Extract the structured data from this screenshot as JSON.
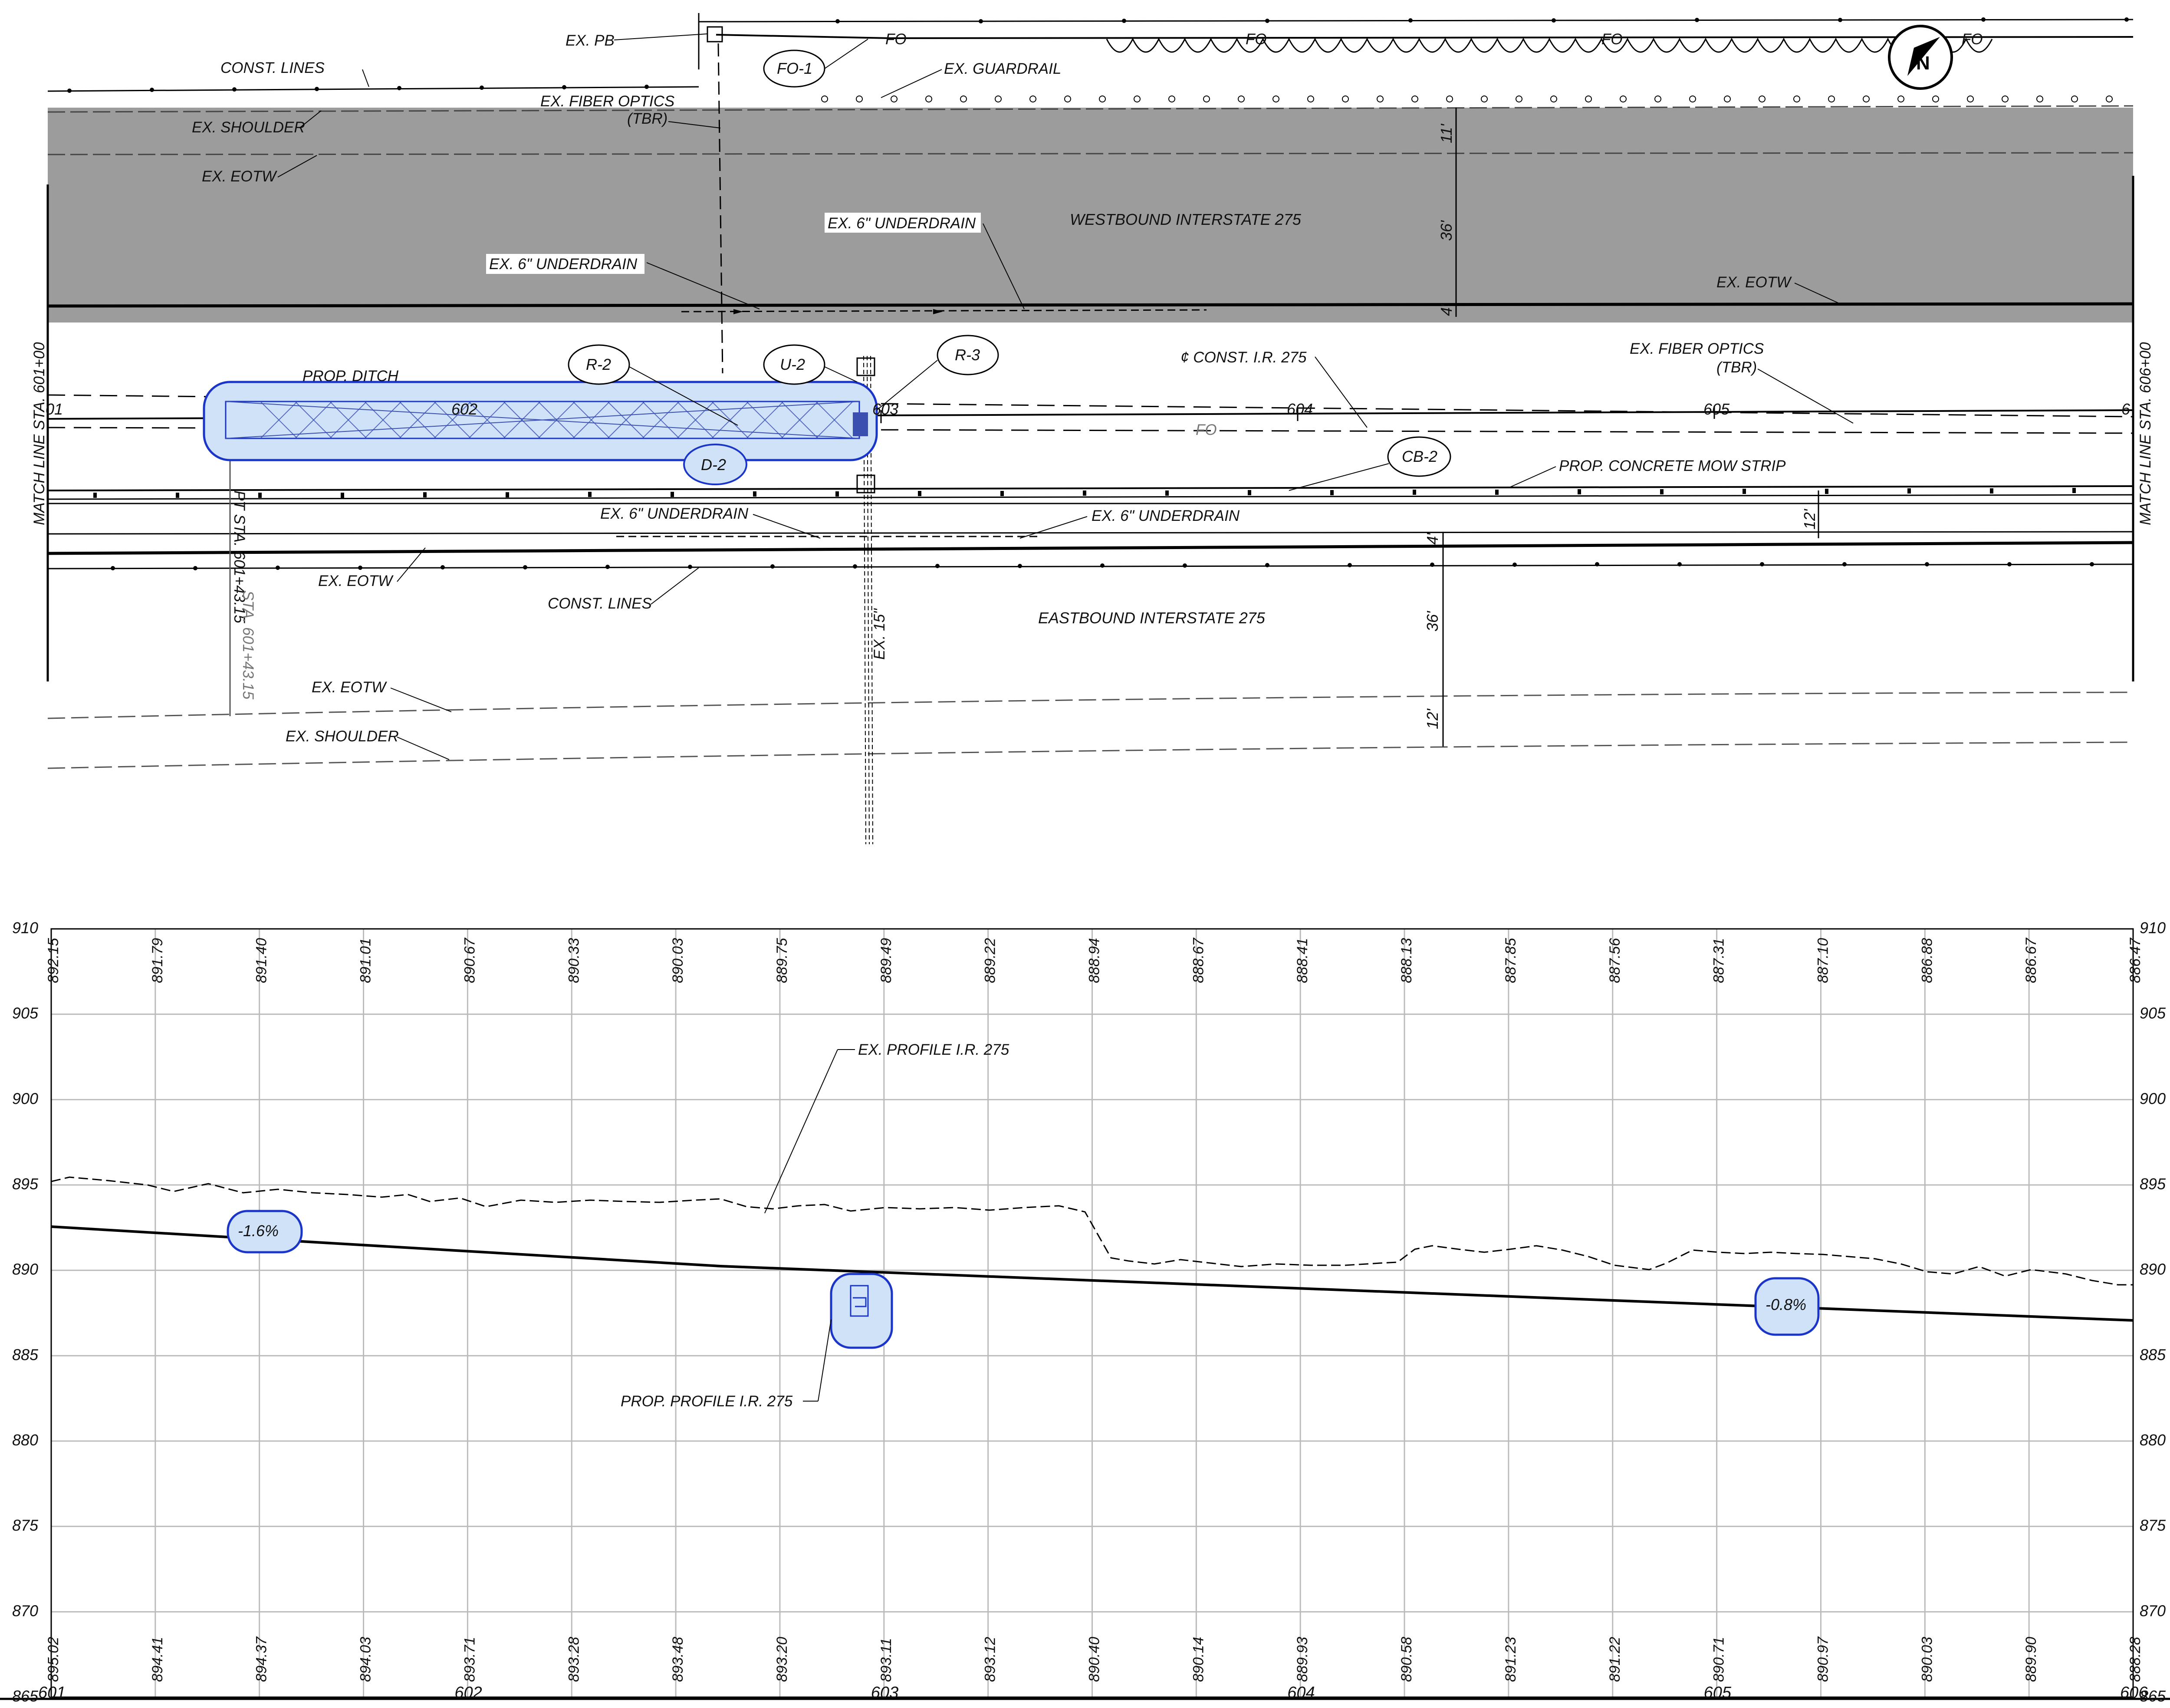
{
  "plan": {
    "labels": {
      "ex_pb": "EX. PB",
      "const_lines_top": "CONST. LINES",
      "ex_fiber_optics_1": "EX. FIBER OPTICS",
      "ex_fiber_optics_1b": "(TBR)",
      "ex_shoulder_top": "EX. SHOULDER",
      "ex_eotw_top": "EX. EOTW",
      "ex_guardrail": "EX. GUARDRAIL",
      "ex_underdrain_a": "EX. 6\" UNDERDRAIN",
      "ex_underdrain_b": "EX. 6\" UNDERDRAIN",
      "westbound": "WESTBOUND INTERSTATE 275",
      "ex_eotw_right": "EX. EOTW",
      "prop_ditch": "PROP. DITCH",
      "const_ir": "¢ CONST. I.R. 275",
      "ex_fiber_optics_2": "EX. FIBER OPTICS",
      "ex_fiber_optics_2b": "(TBR)",
      "prop_mow_strip": "PROP. CONCRETE MOW STRIP",
      "ex_underdrain_c": "EX. 6\" UNDERDRAIN",
      "ex_underdrain_d": "EX. 6\" UNDERDRAIN",
      "ex_eotw_mid": "EX. EOTW",
      "const_lines_mid": "CONST. LINES",
      "eastbound": "EASTBOUND INTERSTATE 275",
      "ex_15": "EX. 15\"",
      "ex_eotw_bottom": "EX. EOTW",
      "ex_shoulder_bottom": "EX. SHOULDER",
      "pt_sta": "PT STA. 601+43.15",
      "pt_sta_ghost": "STA. 601+43.15",
      "match_left": "MATCH LINE STA. 601+00",
      "match_right": "MATCH LINE STA. 606+00",
      "fo_mark": "FO"
    },
    "callouts": {
      "fo1": "FO-1",
      "r2": "R-2",
      "u2": "U-2",
      "r3": "R-3",
      "d2": "D-2",
      "cb2": "CB-2"
    },
    "dimensions": {
      "d11": "11'",
      "d36a": "36'",
      "d4a": "4'",
      "d12a": "12'",
      "d4b": "4'",
      "d36b": "36'",
      "d12b": "12'"
    },
    "stations": {
      "s601": "01",
      "s602": "602",
      "s603": "603",
      "s604": "604",
      "s605": "605",
      "s606": "6"
    }
  },
  "profile": {
    "annotations": {
      "ex_profile": "EX. PROFILE I.R. 275",
      "prop_profile": "PROP. PROFILE I.R. 275",
      "grade1": "-1.6%",
      "grade2": "-0.8%"
    },
    "y_ticks_left": [
      "910",
      "905",
      "900",
      "895",
      "890",
      "885",
      "880",
      "875",
      "870",
      "865"
    ],
    "y_ticks_right": [
      "910",
      "905",
      "900",
      "895",
      "890",
      "885",
      "880",
      "875",
      "870",
      "865"
    ],
    "x_ticks": [
      "601",
      "602",
      "603",
      "604",
      "605",
      "606"
    ],
    "top_elevations": [
      "892.15",
      "891.79",
      "891.40",
      "891.01",
      "890.67",
      "890.33",
      "890.03",
      "889.75",
      "889.49",
      "889.22",
      "888.94",
      "888.67",
      "888.41",
      "888.13",
      "887.85",
      "887.56",
      "887.31",
      "887.10",
      "886.88",
      "886.67",
      "886.47"
    ],
    "bottom_elevations": [
      "895.02",
      "894.41",
      "894.37",
      "894.03",
      "893.71",
      "893.28",
      "893.48",
      "893.20",
      "893.11",
      "893.12",
      "890.40",
      "890.14",
      "889.93",
      "890.58",
      "891.23",
      "891.22",
      "890.71",
      "890.97",
      "890.03",
      "889.90",
      "888.28"
    ]
  }
}
